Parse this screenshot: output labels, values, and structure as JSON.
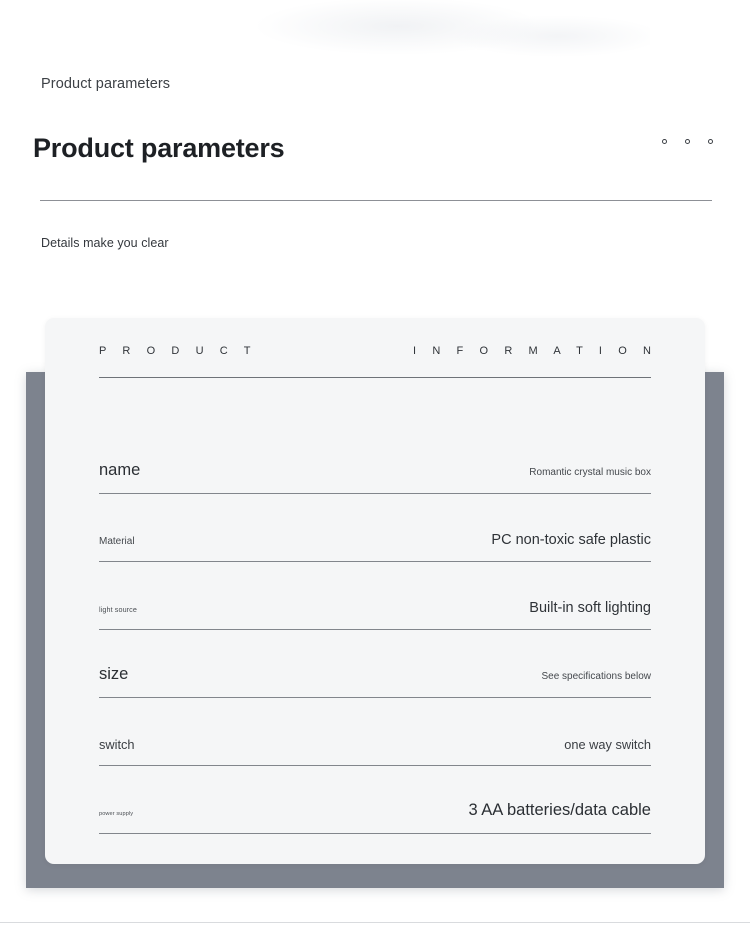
{
  "header": {
    "eyebrow": "Product parameters",
    "title": "Product parameters",
    "subnote": "Details make you clear",
    "menu_dots": [
      "dot",
      "dot",
      "dot"
    ]
  },
  "card": {
    "heading_left": "P R O D U C T",
    "heading_right": "I N F O R M A T I O N",
    "rows": [
      {
        "label": "name",
        "value": "Romantic crystal music box",
        "label_size": "sz-xl",
        "value_size": "sz-sm"
      },
      {
        "label": "Material",
        "value": "PC non-toxic safe plastic",
        "label_size": "sz-sm",
        "value_size": "sz-lg"
      },
      {
        "label": "light source",
        "value": "Built-in soft lighting",
        "label_size": "sz-xs",
        "value_size": "sz-lg"
      },
      {
        "label": "size",
        "value": "See specifications below",
        "label_size": "sz-xl",
        "value_size": "sz-sm"
      },
      {
        "label": "switch",
        "value": "one way switch",
        "label_size": "sz-md",
        "value_size": "sz-md"
      },
      {
        "label": "power supply",
        "value": "3 AA batteries/data cable",
        "label_size": "sz-xxs",
        "value_size": "sz-xl"
      }
    ]
  },
  "colors": {
    "page_background": "#ffffff",
    "card_background": "#f5f6f7",
    "backdrop_panel": "#7d838e",
    "text_primary": "#2f3338",
    "divider": "#8d9096"
  }
}
